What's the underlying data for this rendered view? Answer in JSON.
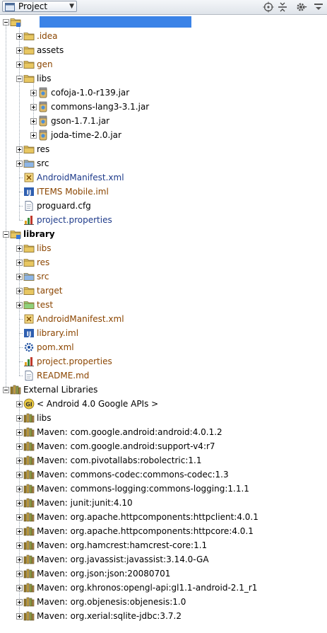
{
  "toolbar": {
    "view_label": "Project",
    "icons": [
      "target-icon",
      "collapse-all-icon",
      "gear-icon",
      "hide-panel-icon"
    ]
  },
  "colors": {
    "folder": "#e8c762",
    "folder_blue": "#8db6e8",
    "folder_green": "#8fd17a",
    "excluded_text": "#8b4500",
    "module_text": "#1d3a8a",
    "selection": "#3b83e7"
  },
  "tree": [
    {
      "label": "",
      "icon": "module-folder-icon",
      "expanded": true,
      "selected": true,
      "depth": 0
    },
    {
      "label": ".idea",
      "icon": "folder-icon",
      "expanded": false,
      "depth": 1,
      "color": "#8b4500"
    },
    {
      "label": "assets",
      "icon": "folder-icon",
      "expanded": false,
      "depth": 1,
      "color": "#000000"
    },
    {
      "label": "gen",
      "icon": "folder-icon",
      "expanded": false,
      "depth": 1,
      "color": "#8b4500"
    },
    {
      "label": "libs",
      "icon": "folder-icon",
      "expanded": true,
      "depth": 1,
      "color": "#000000"
    },
    {
      "label": "cofoja-1.0-r139.jar",
      "icon": "jar-icon",
      "expanded": false,
      "depth": 2,
      "color": "#000000"
    },
    {
      "label": "commons-lang3-3.1.jar",
      "icon": "jar-icon",
      "expanded": false,
      "depth": 2,
      "color": "#000000"
    },
    {
      "label": "gson-1.7.1.jar",
      "icon": "jar-icon",
      "expanded": false,
      "depth": 2,
      "color": "#000000"
    },
    {
      "label": "joda-time-2.0.jar",
      "icon": "jar-icon",
      "expanded": false,
      "depth": 2,
      "color": "#000000"
    },
    {
      "label": "res",
      "icon": "folder-icon",
      "expanded": false,
      "depth": 1,
      "color": "#000000"
    },
    {
      "label": "src",
      "icon": "folder-blue-icon",
      "expanded": false,
      "depth": 1,
      "color": "#000000"
    },
    {
      "label": "AndroidManifest.xml",
      "icon": "xml-file-icon",
      "leaf": true,
      "depth": 1,
      "color": "#1d3a8a"
    },
    {
      "label": "ITEMS Mobile.iml",
      "icon": "iml-file-icon",
      "leaf": true,
      "depth": 1,
      "color": "#8b4500"
    },
    {
      "label": "proguard.cfg",
      "icon": "text-file-icon",
      "leaf": true,
      "depth": 1,
      "color": "#000000"
    },
    {
      "label": "project.properties",
      "icon": "properties-file-icon",
      "leaf": true,
      "depth": 1,
      "color": "#1d3a8a"
    },
    {
      "label": "library",
      "icon": "module-folder-icon",
      "expanded": true,
      "depth": 0,
      "bold": true,
      "color": "#000000"
    },
    {
      "label": "libs",
      "icon": "folder-icon",
      "expanded": false,
      "depth": 1,
      "color": "#8b4500"
    },
    {
      "label": "res",
      "icon": "folder-icon",
      "expanded": false,
      "depth": 1,
      "color": "#8b4500"
    },
    {
      "label": "src",
      "icon": "folder-blue-icon",
      "expanded": false,
      "depth": 1,
      "color": "#8b4500"
    },
    {
      "label": "target",
      "icon": "folder-icon",
      "expanded": false,
      "depth": 1,
      "color": "#8b4500"
    },
    {
      "label": "test",
      "icon": "folder-green-icon",
      "expanded": false,
      "depth": 1,
      "color": "#8b4500"
    },
    {
      "label": "AndroidManifest.xml",
      "icon": "xml-file-icon",
      "leaf": true,
      "depth": 1,
      "color": "#8b4500"
    },
    {
      "label": "library.iml",
      "icon": "iml-file-icon",
      "leaf": true,
      "depth": 1,
      "color": "#8b4500"
    },
    {
      "label": "pom.xml",
      "icon": "maven-pom-icon",
      "leaf": true,
      "depth": 1,
      "color": "#8b4500"
    },
    {
      "label": "project.properties",
      "icon": "properties-file-icon",
      "leaf": true,
      "depth": 1,
      "color": "#8b4500"
    },
    {
      "label": "README.md",
      "icon": "text-file-icon",
      "leaf": true,
      "depth": 1,
      "color": "#8b4500"
    },
    {
      "label": "External Libraries",
      "icon": "library-icon",
      "expanded": true,
      "depth": 0,
      "color": "#000000"
    },
    {
      "label": "< Android 4.0 Google APIs >",
      "icon": "sdk-icon",
      "expanded": false,
      "depth": 1,
      "color": "#000000"
    },
    {
      "label": "libs",
      "icon": "library-icon",
      "expanded": false,
      "depth": 1,
      "color": "#000000"
    },
    {
      "label": "Maven: com.google.android:android:4.0.1.2",
      "icon": "library-icon",
      "expanded": false,
      "depth": 1,
      "color": "#000000"
    },
    {
      "label": "Maven: com.google.android:support-v4:r7",
      "icon": "library-icon",
      "expanded": false,
      "depth": 1,
      "color": "#000000"
    },
    {
      "label": "Maven: com.pivotallabs:robolectric:1.1",
      "icon": "library-icon",
      "expanded": false,
      "depth": 1,
      "color": "#000000"
    },
    {
      "label": "Maven: commons-codec:commons-codec:1.3",
      "icon": "library-icon",
      "expanded": false,
      "depth": 1,
      "color": "#000000"
    },
    {
      "label": "Maven: commons-logging:commons-logging:1.1.1",
      "icon": "library-icon",
      "expanded": false,
      "depth": 1,
      "color": "#000000"
    },
    {
      "label": "Maven: junit:junit:4.10",
      "icon": "library-icon",
      "expanded": false,
      "depth": 1,
      "color": "#000000"
    },
    {
      "label": "Maven: org.apache.httpcomponents:httpclient:4.0.1",
      "icon": "library-icon",
      "expanded": false,
      "depth": 1,
      "color": "#000000"
    },
    {
      "label": "Maven: org.apache.httpcomponents:httpcore:4.0.1",
      "icon": "library-icon",
      "expanded": false,
      "depth": 1,
      "color": "#000000"
    },
    {
      "label": "Maven: org.hamcrest:hamcrest-core:1.1",
      "icon": "library-icon",
      "expanded": false,
      "depth": 1,
      "color": "#000000"
    },
    {
      "label": "Maven: org.javassist:javassist:3.14.0-GA",
      "icon": "library-icon",
      "expanded": false,
      "depth": 1,
      "color": "#000000"
    },
    {
      "label": "Maven: org.json:json:20080701",
      "icon": "library-icon",
      "expanded": false,
      "depth": 1,
      "color": "#000000"
    },
    {
      "label": "Maven: org.khronos:opengl-api:gl1.1-android-2.1_r1",
      "icon": "library-icon",
      "expanded": false,
      "depth": 1,
      "color": "#000000"
    },
    {
      "label": "Maven: org.objenesis:objenesis:1.0",
      "icon": "library-icon",
      "expanded": false,
      "depth": 1,
      "color": "#000000"
    },
    {
      "label": "Maven: org.xerial:sqlite-jdbc:3.7.2",
      "icon": "library-icon",
      "expanded": false,
      "depth": 1,
      "color": "#000000"
    }
  ]
}
